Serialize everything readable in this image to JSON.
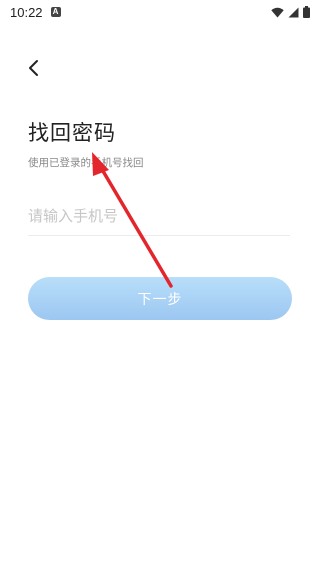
{
  "status_bar": {
    "time": "10:22",
    "notification_letter": "A",
    "icons": [
      "wifi-icon",
      "signal-icon",
      "battery-icon"
    ]
  },
  "nav": {
    "back_icon": "chevron-left-icon"
  },
  "title": "找回密码",
  "subtitle": "使用已登录的手机号找回",
  "phone_input": {
    "placeholder": "请输入手机号",
    "value": ""
  },
  "next_button": {
    "label": "下一步"
  },
  "colors": {
    "button_top": "#b8def9",
    "button_bottom": "#9cc7f1",
    "annotation_arrow": "#e3262b",
    "title": "#222222",
    "subtitle": "#888888",
    "placeholder": "#c6c6c6"
  }
}
